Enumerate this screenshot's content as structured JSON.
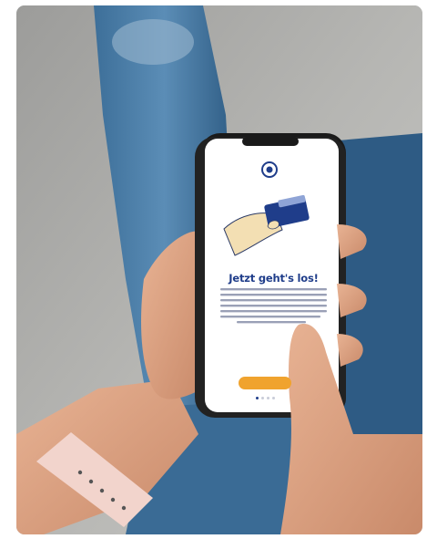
{
  "screen": {
    "title": "Jetzt geht's los!",
    "cta_label": "",
    "pager": {
      "count": 4,
      "active": 0
    }
  },
  "colors": {
    "brand_blue": "#1f3d8a",
    "button_orange": "#f0a32e",
    "screen_white": "#ffffff",
    "jeans_blue": "#2c5c86"
  },
  "icons": [
    "bank-logo-icon",
    "card-in-hand-illustration"
  ]
}
